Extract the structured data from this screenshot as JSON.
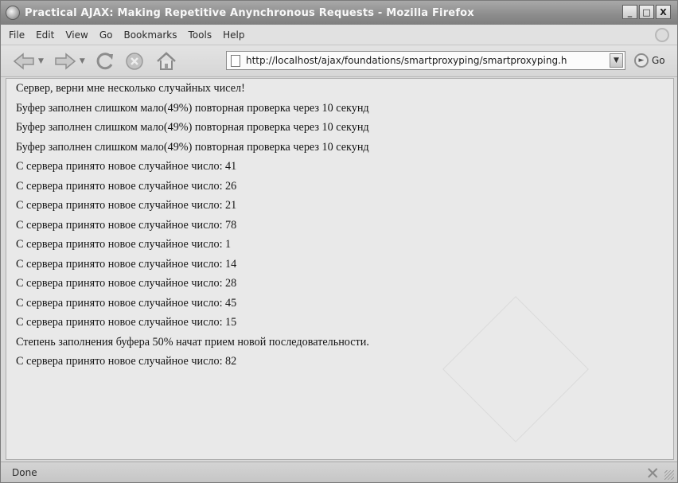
{
  "window": {
    "title": "Practical AJAX: Making Repetitive Anynchronous Requests - Mozilla Firefox",
    "minimize_label": "_",
    "maximize_label": "□",
    "close_label": "X"
  },
  "menu": {
    "items": [
      {
        "label": "File"
      },
      {
        "label": "Edit"
      },
      {
        "label": "View"
      },
      {
        "label": "Go"
      },
      {
        "label": "Bookmarks"
      },
      {
        "label": "Tools"
      },
      {
        "label": "Help"
      }
    ]
  },
  "toolbar": {
    "url": "http://localhost/ajax/foundations/smartproxyping/smartproxyping.h",
    "go_label": "Go",
    "icons": [
      "back-icon",
      "forward-icon",
      "reload-icon",
      "stop-icon",
      "home-icon"
    ]
  },
  "content": {
    "lines": [
      "Сервер, верни мне несколько случайных чисел!",
      "Буфер заполнен слишком мало(49%) повторная проверка через 10 секунд",
      "Буфер заполнен слишком мало(49%) повторная проверка через 10 секунд",
      "Буфер заполнен слишком мало(49%) повторная проверка через 10 секунд",
      "С сервера принято новое случайное число:  41",
      "С сервера принято новое случайное число:  26",
      "С сервера принято новое случайное число:  21",
      "С сервера принято новое случайное число:  78",
      "С сервера принято новое случайное число:  1",
      "С сервера принято новое случайное число:  14",
      "С сервера принято новое случайное число:  28",
      "С сервера принято новое случайное число:  45",
      "С сервера принято новое случайное число:  15",
      "Степень заполнения буфера 50% начат прием новой последовательности.",
      "С сервера принято новое случайное число: 82"
    ]
  },
  "status": {
    "text": "Done"
  }
}
